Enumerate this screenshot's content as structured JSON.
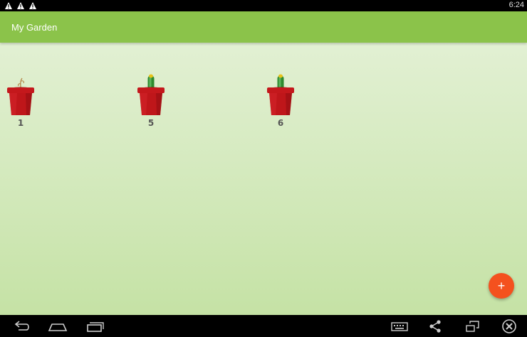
{
  "status_bar": {
    "time": "6:24",
    "notifications": [
      "warning-icon",
      "warning-icon",
      "warning-icon"
    ]
  },
  "app_bar": {
    "title": "My Garden"
  },
  "pots": [
    {
      "label": "1",
      "plant": "sprout"
    },
    {
      "label": "5",
      "plant": "cactus"
    },
    {
      "label": "6",
      "plant": "cactus"
    }
  ],
  "fab": {
    "label": "+"
  },
  "nav_bar": {
    "left": [
      "back-icon",
      "home-icon",
      "recents-icon"
    ],
    "right": [
      "keyboard-icon",
      "share-icon",
      "window-icon",
      "close-icon"
    ]
  },
  "colors": {
    "app_bar": "#8bc34a",
    "fab": "#f4511e",
    "pot": "#c0161a",
    "background": "#d5eabf"
  }
}
